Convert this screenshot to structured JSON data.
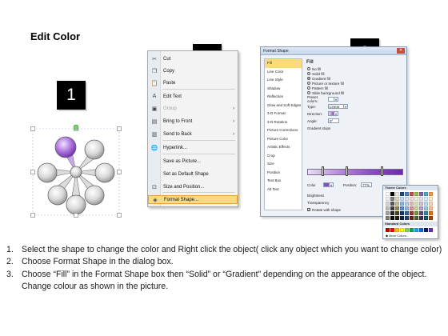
{
  "title": "Edit Color",
  "badges": [
    "1",
    "2",
    "3"
  ],
  "context_menu": {
    "items": [
      {
        "label": "Cut",
        "icon": "scissors-icon",
        "glyph": "✂"
      },
      {
        "label": "Copy",
        "icon": "copy-icon",
        "glyph": "❐"
      },
      {
        "label": "Paste",
        "icon": "paste-icon",
        "glyph": "📋"
      },
      {
        "label": "Edit Text",
        "icon": "edit-text-icon",
        "glyph": "A"
      },
      {
        "label": "Group",
        "icon": "group-icon",
        "glyph": "▣",
        "disabled": true,
        "submenu": true
      },
      {
        "label": "Bring to Front",
        "icon": "bring-front-icon",
        "glyph": "▤",
        "submenu": true
      },
      {
        "label": "Send to Back",
        "icon": "send-back-icon",
        "glyph": "▥",
        "submenu": true
      },
      {
        "label": "Hyperlink...",
        "icon": "hyperlink-icon",
        "glyph": "🌐"
      },
      {
        "label": "Save as Picture...",
        "icon": "",
        "glyph": ""
      },
      {
        "label": "Set as Default Shape",
        "icon": "",
        "glyph": ""
      },
      {
        "label": "Size and Position...",
        "icon": "size-position-icon",
        "glyph": "⊡"
      },
      {
        "label": "Format Shape...",
        "icon": "format-shape-icon",
        "glyph": "◈",
        "highlighted": true
      }
    ]
  },
  "dialog": {
    "title": "Format Shape",
    "nav": [
      "Fill",
      "Line Color",
      "Line Style",
      "Shadow",
      "Reflection",
      "Glow and Soft Edges",
      "3-D Format",
      "3-D Rotation",
      "Picture Corrections",
      "Picture Color",
      "Artistic Effects",
      "Crop",
      "Size",
      "Position",
      "Text Box",
      "Alt Text"
    ],
    "fill_heading": "Fill",
    "fill_options": [
      "No fill",
      "Solid fill",
      "Gradient fill",
      "Picture or texture fill",
      "Pattern fill",
      "Slide background fill"
    ],
    "preset_label": "Preset colors:",
    "type_label": "Type:",
    "type_value": "Linear",
    "direction_label": "Direction:",
    "angle_label": "Angle:",
    "angle_value": "0°",
    "stops_label": "Gradient stops",
    "color_label": "Color",
    "position_label": "Position:",
    "position_value": "77%",
    "brightness_label": "Brightness",
    "transparency_label": "Transparency",
    "rotate_label": "Rotate with shape",
    "theme_colors_label": "Theme Colors",
    "standard_colors_label": "Standard Colors",
    "more_colors_label": "More Colors...",
    "theme_colors": [
      [
        "#ffffff",
        "#000000",
        "#eeece1",
        "#1f497d",
        "#4f81bd",
        "#c0504d",
        "#9bbb59",
        "#8064a2",
        "#4bacc6",
        "#f79646"
      ],
      [
        "#f2f2f2",
        "#7f7f7f",
        "#ddd9c3",
        "#c6d9f0",
        "#dbe5f1",
        "#f2dcdb",
        "#ebf1dd",
        "#e5e0ec",
        "#dbeef3",
        "#fdeada"
      ],
      [
        "#d8d8d8",
        "#595959",
        "#c4bd97",
        "#8db3e2",
        "#b8cce4",
        "#e5b9b7",
        "#d7e3bc",
        "#ccc1d9",
        "#b7dde8",
        "#fbd5b5"
      ],
      [
        "#bfbfbf",
        "#3f3f3f",
        "#938953",
        "#548dd4",
        "#95b3d7",
        "#d99694",
        "#c3d69b",
        "#b2a2c7",
        "#92cddc",
        "#fac08f"
      ],
      [
        "#a5a5a5",
        "#262626",
        "#494429",
        "#17365d",
        "#366092",
        "#953734",
        "#76923c",
        "#5f497a",
        "#31859b",
        "#e36c09"
      ],
      [
        "#7f7f7f",
        "#0c0c0c",
        "#1d1b10",
        "#0f243e",
        "#244061",
        "#632423",
        "#4f6128",
        "#3f3151",
        "#205867",
        "#974806"
      ]
    ],
    "standard_colors": [
      "#c00000",
      "#ff0000",
      "#ffc000",
      "#ffff00",
      "#92d050",
      "#00b050",
      "#00b0f0",
      "#0070c0",
      "#002060",
      "#7030a0"
    ]
  },
  "instructions": [
    {
      "num": "1.",
      "text": "Select the shape to change the color and Right click the object( click any object which you want to change color)"
    },
    {
      "num": "2.",
      "text": "Choose Format Shape in the dialog box."
    },
    {
      "num": "3.",
      "text": "Choose “Fill” in the Format Shape box then “Solid” or “Gradient” depending on the appearance of the object. Change colour as shown in the picture."
    }
  ]
}
